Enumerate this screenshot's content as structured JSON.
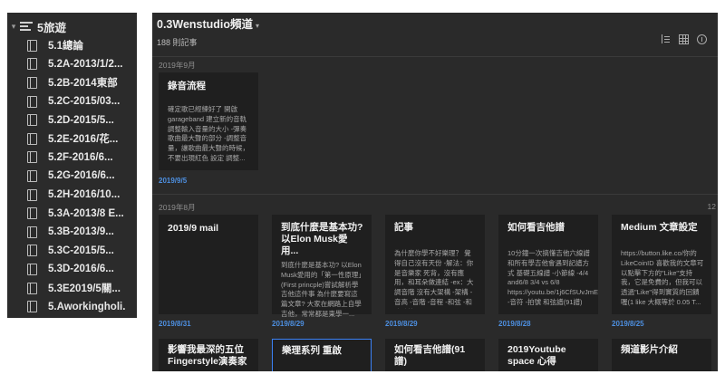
{
  "sidebar": {
    "parent": {
      "label": "5旅遊"
    },
    "items": [
      {
        "label": "5.1總論"
      },
      {
        "label": "5.2A-2013/1/2..."
      },
      {
        "label": "5.2B-2014東部"
      },
      {
        "label": "5.2C-2015/03..."
      },
      {
        "label": "5.2D-2015/5..."
      },
      {
        "label": "5.2E-2016/花..."
      },
      {
        "label": "5.2F-2016/6..."
      },
      {
        "label": "5.2G-2016/6..."
      },
      {
        "label": "5.2H-2016/10..."
      },
      {
        "label": "5.3A-2013/8 E..."
      },
      {
        "label": "5.3B-2013/9..."
      },
      {
        "label": "5.3C-2015/5..."
      },
      {
        "label": "5.3D-2016/6..."
      },
      {
        "label": "5.3E2019/5關..."
      },
      {
        "label": "5.Aworkingholi..."
      }
    ]
  },
  "notebook": {
    "title": "0.3Wenstudio頻道",
    "count": "188 則記事"
  },
  "months": [
    {
      "label": "2019年9月"
    },
    {
      "label": "2019年8月"
    }
  ],
  "sep_counter": "12",
  "cards": [
    {
      "title": "錄音流程",
      "body": "確定歌已經練好了 開啟garageband 建立新的音軌 調整輸入音量的大小 -彈奏歌曲最大聲的部分 -調整音量，讓歌曲最大聲的時候，不要出現紅色 設定 調整...",
      "date": "2019/9/5"
    },
    {
      "title": "2019/9 mail",
      "body": "",
      "date": "2019/8/31"
    },
    {
      "title": "到底什麼是基本功?以Elon Musk愛用...",
      "body": "到底什麼是基本功? 以Elon Musk愛用的「第一性原理」(First princple)嘗試解析學吉他這件事 為什麼要寫這篇文章? 大家在網路上自學吉他，常常都是東學一...",
      "date": "2019/8/29"
    },
    {
      "title": "記事",
      "body": "為什麼你學不好樂理？ 覺得自己沒有天份 -解法：你是音樂家 死背，沒有應用，和耳朵做連結 -ex：大調音階 沒有大架構 -架構 -音高 -音階 -音程 -和弦 -和弦功能...",
      "date": "2019/8/29"
    },
    {
      "title": "如何看吉他譜",
      "body": "10分鐘一次搞懂吉他六線譜和所有學吉他會遇到記譜方式 基礎五線譜 -小節線 -4/4 and6/8 3/4 vs 6/8 https://youtu.be/1j6CfSUvJmE -音符 -拍號 和弦譜(91譜) -...",
      "date": "2019/8/28"
    },
    {
      "title": "Medium 文章設定",
      "body": "https://button.like.co/你的LikeCoinID 喜歡我的文章可以點擊下方的\"Like\"支持我，它是免費的，但我可以透過\"Like\"得到實質的回饋喔(1 like 大概等於 0.05 T...",
      "date": "2019/8/25"
    },
    {
      "title": "影響我最深的五位Fingerstyle演奏家",
      "body": "",
      "date": ""
    },
    {
      "title": "樂理系列 重啟",
      "body": "",
      "date": ""
    },
    {
      "title": "如何看吉他譜(91譜)",
      "body": "",
      "date": ""
    },
    {
      "title": "2019Youtube space 心得",
      "body": "",
      "date": ""
    },
    {
      "title": "頻道影片介紹",
      "body": "",
      "date": ""
    }
  ]
}
